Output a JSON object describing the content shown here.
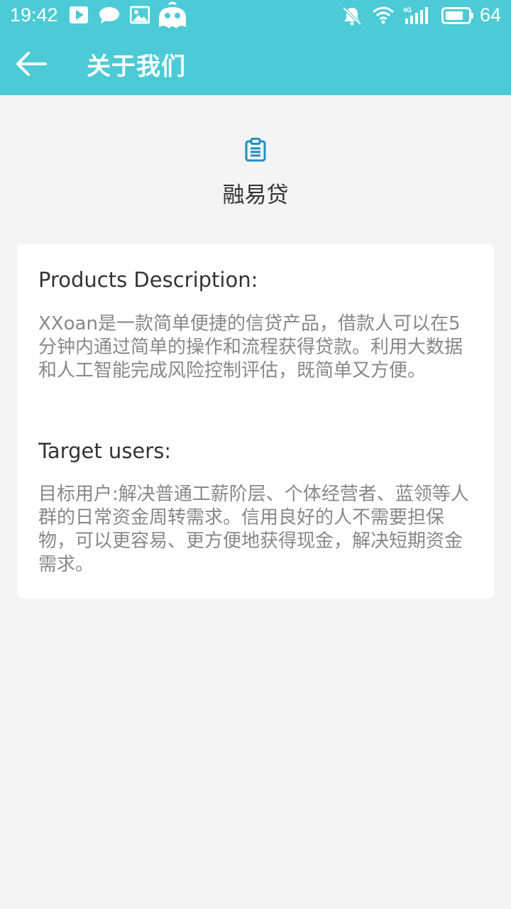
{
  "status_bar": {
    "time": "19:42",
    "battery": "64",
    "icons": [
      "play-icon",
      "chat-icon",
      "image-icon",
      "mascot-icon",
      "bell-off-icon",
      "wifi-icon",
      "signal-4g-icon",
      "battery-icon"
    ]
  },
  "app_bar": {
    "title": "关于我们",
    "back_icon": "arrow-left-icon"
  },
  "product": {
    "icon": "clipboard-icon",
    "name": "融易贷"
  },
  "content": {
    "description_heading": "Products Description:",
    "description_text": "XXoan是一款简单便捷的信贷产品，借款人可以在5分钟内通过简单的操作和流程获得贷款。利用大数据和人工智能完成风险控制评估，既简单又方便。",
    "target_heading": "Target users:",
    "target_text": "目标用户:解决普通工薪阶层、个体经营者、蓝领等人群的日常资金周转需求。信用良好的人不需要担保物，可以更容易、更方便地获得现金，解决短期资金需求。"
  },
  "colors": {
    "primary": "#4ccbd6",
    "background": "#f4f4f4",
    "card": "#ffffff",
    "icon_accent": "#1f8fc4"
  }
}
